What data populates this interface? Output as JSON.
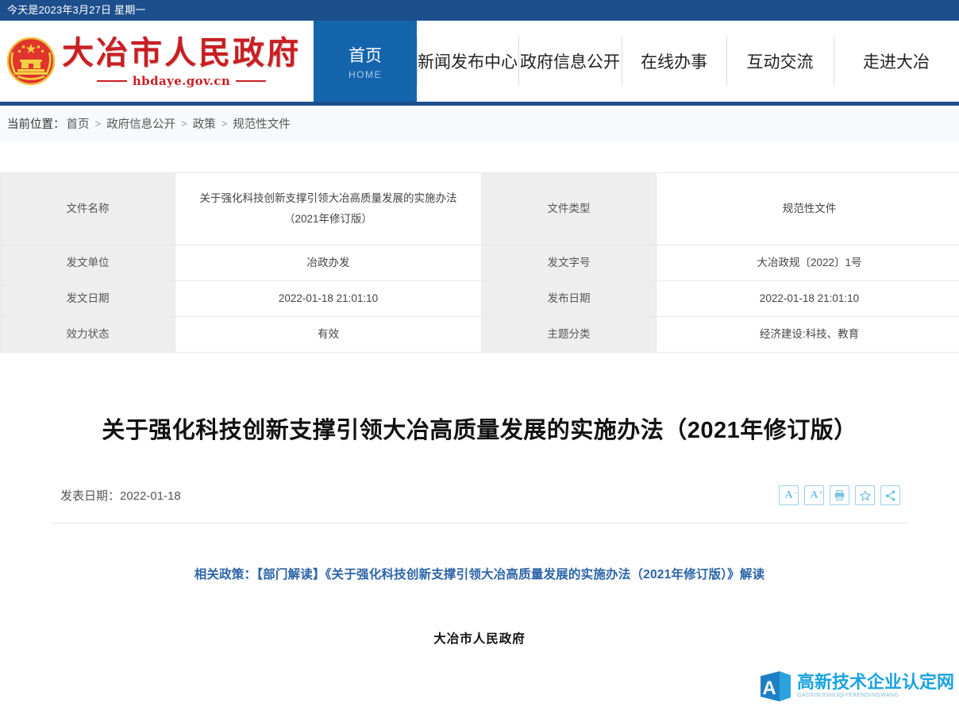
{
  "topbar": {
    "date_text": "今天是2023年3月27日  星期一",
    "bg_color": "#1d4f8c"
  },
  "header": {
    "site_title": "大冶市人民政府",
    "domain": "hbdaye.gov.cn",
    "emblem_name": "national-emblem",
    "brand_color": "#c81f23"
  },
  "nav": {
    "active_color": "#1565ad",
    "items": [
      {
        "label": "首页",
        "sub": "HOME",
        "active": true
      },
      {
        "label": "新闻发布中心",
        "sub": "",
        "active": false
      },
      {
        "label": "政府信息公开",
        "sub": "",
        "active": false
      },
      {
        "label": "在线办事",
        "sub": "",
        "active": false
      },
      {
        "label": "互动交流",
        "sub": "",
        "active": false
      },
      {
        "label": "走进大冶",
        "sub": "",
        "active": false
      }
    ]
  },
  "breadcrumb": {
    "label": "当前位置：",
    "items": [
      "首页",
      "政府信息公开",
      "政策",
      "规范性文件"
    ],
    "separator": ">"
  },
  "meta_table": {
    "rows": [
      {
        "label_left": "文件名称",
        "value_left": "关于强化科技创新支撑引领大冶高质量发展的实施办法\n（2021年修订版）",
        "label_right": "文件类型",
        "value_right": "规范性文件"
      },
      {
        "label_left": "发文单位",
        "value_left": "冶政办发",
        "label_right": "发文字号",
        "value_right": "大冶政规〔2022〕1号"
      },
      {
        "label_left": "发文日期",
        "value_left": "2022-01-18 21:01:10",
        "label_right": "发布日期",
        "value_right": "2022-01-18 21:01:10"
      },
      {
        "label_left": "效力状态",
        "value_left": "有效",
        "label_right": "主题分类",
        "value_right": "经济建设:科技、教育"
      }
    ]
  },
  "article": {
    "title": "关于强化科技创新支撑引领大冶高质量发展的实施办法（2021年修订版）",
    "publish_date_label": "发表日期：",
    "publish_date": "2022-01-18",
    "publish_date_full": "发表日期：2022-01-18",
    "tools": [
      {
        "name": "font-decrease-icon",
        "label": "A",
        "sup": "-",
        "title": "缩小字体"
      },
      {
        "name": "font-increase-icon",
        "label": "A",
        "sup": "+",
        "title": "放大字体"
      },
      {
        "name": "print-icon",
        "label": "",
        "sup": "",
        "title": "打印"
      },
      {
        "name": "favorite-star-icon",
        "label": "",
        "sup": "",
        "title": "收藏"
      },
      {
        "name": "share-icon",
        "label": "",
        "sup": "",
        "title": "分享"
      }
    ],
    "related_label": "相关政策：",
    "related_link": "【部门解读】《关于强化科技创新支撑引领大冶高质量发展的实施办法（2021年修订版）》解读",
    "related_full": "相关政策：【部门解读】《关于强化科技创新支撑引领大冶高质量发展的实施办法（2021年修订版）》解读",
    "signature": "大冶市人民政府",
    "link_color": "#2c64a8"
  },
  "watermark": {
    "cn": "高新技术企业认定网",
    "pinyin": "GAOXINJISHUQIYERENDINGWANG",
    "mark_letter": "A",
    "color": "#1ba3e0"
  }
}
